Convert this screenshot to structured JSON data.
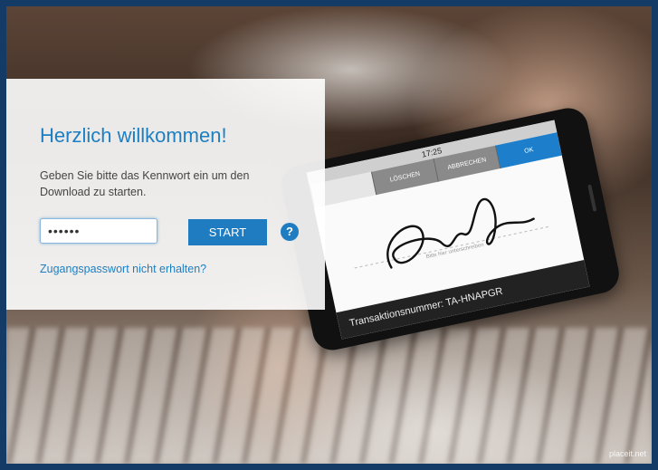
{
  "login": {
    "title": "Herzlich willkommen!",
    "description": "Geben Sie bitte das Kennwort ein um den Download zu starten.",
    "password_value": "••••••",
    "start_label": "START",
    "help_label": "?",
    "forgot_link": "Zugangspasswort nicht erhalten?"
  },
  "phone": {
    "time": "17:25",
    "tab_delete": "LÖSCHEN",
    "tab_cancel": "ABBRECHEN",
    "tab_ok": "OK",
    "signature_hint": "Bitte hier unterschreiben",
    "transaction": "Transaktionsnummer: TA-HNAPGR"
  },
  "watermark": "placeit.net",
  "colors": {
    "accent": "#1d7fc1",
    "frame": "#143b66"
  },
  "icons": {
    "help": "question-mark-icon"
  }
}
